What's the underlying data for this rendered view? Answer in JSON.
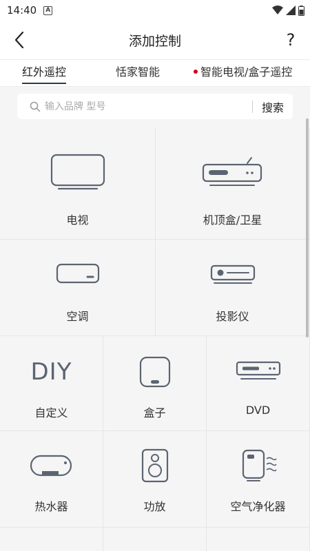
{
  "status_bar": {
    "time": "14:40",
    "notification_letter": "A"
  },
  "header": {
    "title": "添加控制",
    "help_label": "?"
  },
  "tabs": [
    {
      "label": "红外遥控",
      "active": true
    },
    {
      "label": "恬家智能",
      "active": false
    },
    {
      "label": "智能电视/盒子遥控",
      "active": false,
      "has_red_dot": true
    }
  ],
  "search": {
    "placeholder": "输入品牌 型号",
    "value": "",
    "button_label": "搜索"
  },
  "devices": {
    "tv": {
      "label": "电视",
      "icon": "tv-icon"
    },
    "settop": {
      "label": "机顶盒/卫星",
      "icon": "set-top-box-icon"
    },
    "ac": {
      "label": "空调",
      "icon": "air-conditioner-icon"
    },
    "projector": {
      "label": "投影仪",
      "icon": "projector-icon"
    },
    "diy": {
      "label": "自定义",
      "icon_text": "DIY",
      "icon": "diy-icon"
    },
    "box": {
      "label": "盒子",
      "icon": "box-icon"
    },
    "dvd": {
      "label": "DVD",
      "icon": "dvd-icon"
    },
    "heater": {
      "label": "热水器",
      "icon": "water-heater-icon"
    },
    "amp": {
      "label": "功放",
      "icon": "speaker-icon"
    },
    "purifier": {
      "label": "空气净化器",
      "icon": "air-purifier-icon"
    }
  },
  "colors": {
    "icon_stroke": "#5b6472",
    "accent_dot": "#d0021b",
    "tab_underline": "#2b3a4a"
  }
}
